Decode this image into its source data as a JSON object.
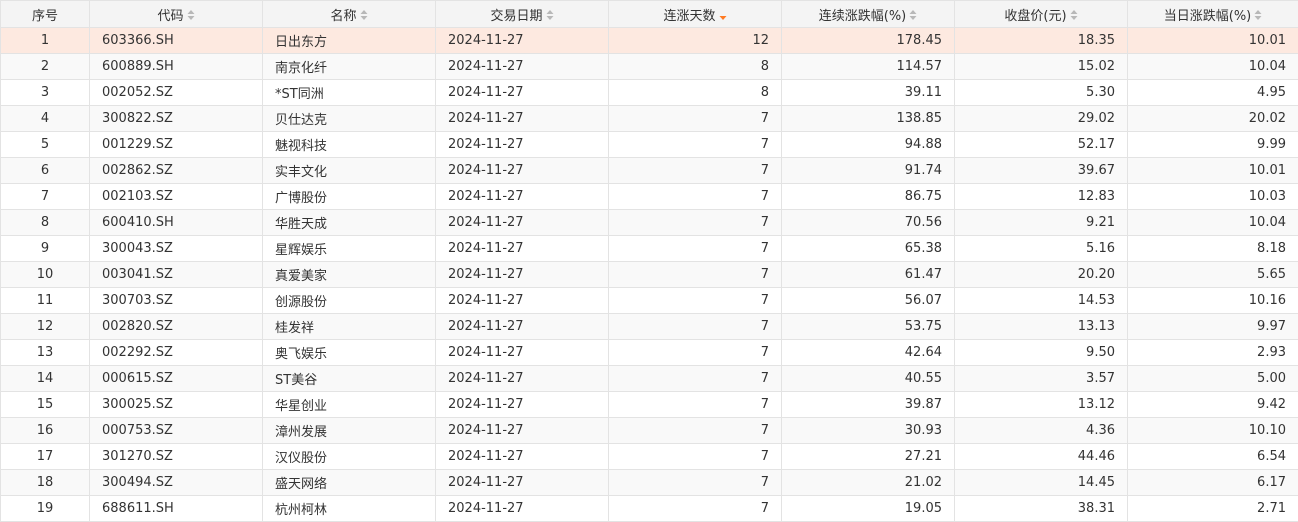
{
  "colors": {
    "header_bg": "#f4f4f4",
    "row_highlight": "#fde9e0",
    "row_alt": "#f9f9f9",
    "border": "#e3e3e3",
    "sort_active": "#ff7a22",
    "sort_inactive": "#b8b8b8"
  },
  "table": {
    "columns": [
      {
        "key": "index",
        "label": "序号",
        "sort": "none"
      },
      {
        "key": "code",
        "label": "代码",
        "sort": "inactive"
      },
      {
        "key": "name",
        "label": "名称",
        "sort": "inactive"
      },
      {
        "key": "date",
        "label": "交易日期",
        "sort": "inactive"
      },
      {
        "key": "streak_days",
        "label": "连涨天数",
        "sort": "desc"
      },
      {
        "key": "streak_change",
        "label": "连续涨跌幅(%)",
        "sort": "inactive"
      },
      {
        "key": "close",
        "label": "收盘价(元)",
        "sort": "inactive"
      },
      {
        "key": "day_change",
        "label": "当日涨跌幅(%)",
        "sort": "inactive"
      }
    ],
    "rows": [
      [
        "1",
        "603366.SH",
        "日出东方",
        "2024-11-27",
        "12",
        "178.45",
        "18.35",
        "10.01"
      ],
      [
        "2",
        "600889.SH",
        "南京化纤",
        "2024-11-27",
        "8",
        "114.57",
        "15.02",
        "10.04"
      ],
      [
        "3",
        "002052.SZ",
        "*ST同洲",
        "2024-11-27",
        "8",
        "39.11",
        "5.30",
        "4.95"
      ],
      [
        "4",
        "300822.SZ",
        "贝仕达克",
        "2024-11-27",
        "7",
        "138.85",
        "29.02",
        "20.02"
      ],
      [
        "5",
        "001229.SZ",
        "魅视科技",
        "2024-11-27",
        "7",
        "94.88",
        "52.17",
        "9.99"
      ],
      [
        "6",
        "002862.SZ",
        "实丰文化",
        "2024-11-27",
        "7",
        "91.74",
        "39.67",
        "10.01"
      ],
      [
        "7",
        "002103.SZ",
        "广博股份",
        "2024-11-27",
        "7",
        "86.75",
        "12.83",
        "10.03"
      ],
      [
        "8",
        "600410.SH",
        "华胜天成",
        "2024-11-27",
        "7",
        "70.56",
        "9.21",
        "10.04"
      ],
      [
        "9",
        "300043.SZ",
        "星辉娱乐",
        "2024-11-27",
        "7",
        "65.38",
        "5.16",
        "8.18"
      ],
      [
        "10",
        "003041.SZ",
        "真爱美家",
        "2024-11-27",
        "7",
        "61.47",
        "20.20",
        "5.65"
      ],
      [
        "11",
        "300703.SZ",
        "创源股份",
        "2024-11-27",
        "7",
        "56.07",
        "14.53",
        "10.16"
      ],
      [
        "12",
        "002820.SZ",
        "桂发祥",
        "2024-11-27",
        "7",
        "53.75",
        "13.13",
        "9.97"
      ],
      [
        "13",
        "002292.SZ",
        "奥飞娱乐",
        "2024-11-27",
        "7",
        "42.64",
        "9.50",
        "2.93"
      ],
      [
        "14",
        "000615.SZ",
        "ST美谷",
        "2024-11-27",
        "7",
        "40.55",
        "3.57",
        "5.00"
      ],
      [
        "15",
        "300025.SZ",
        "华星创业",
        "2024-11-27",
        "7",
        "39.87",
        "13.12",
        "9.42"
      ],
      [
        "16",
        "000753.SZ",
        "漳州发展",
        "2024-11-27",
        "7",
        "30.93",
        "4.36",
        "10.10"
      ],
      [
        "17",
        "301270.SZ",
        "汉仪股份",
        "2024-11-27",
        "7",
        "27.21",
        "44.46",
        "6.54"
      ],
      [
        "18",
        "300494.SZ",
        "盛天网络",
        "2024-11-27",
        "7",
        "21.02",
        "14.45",
        "6.17"
      ],
      [
        "19",
        "688611.SH",
        "杭州柯林",
        "2024-11-27",
        "7",
        "19.05",
        "38.31",
        "2.71"
      ]
    ]
  }
}
